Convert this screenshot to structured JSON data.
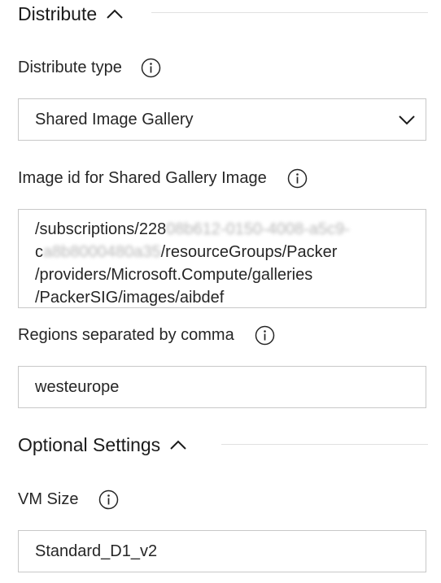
{
  "distribute_section": {
    "title": "Distribute",
    "collapse_icon": "chevron-up-icon"
  },
  "distribute_type": {
    "label": "Distribute type",
    "info_icon": "info-icon",
    "value": "Shared Image Gallery",
    "dropdown_icon": "chevron-down-icon"
  },
  "image_id": {
    "label": "Image id for Shared Gallery Image",
    "info_icon": "info-icon",
    "lines": [
      {
        "prefix": "/subscriptions/228",
        "hidden": "08b612-0150-4008-a5c9-",
        "suffix": ""
      },
      {
        "prefix": "c",
        "hidden": "a8b8000480a35",
        "suffix": "/resourceGroups/Packer"
      },
      {
        "prefix": "/providers/Microsoft.Compute/galleries",
        "hidden": "",
        "suffix": ""
      },
      {
        "prefix": "/PackerSIG/images/aibdef",
        "hidden": "",
        "suffix": ""
      }
    ]
  },
  "regions": {
    "label": "Regions separated by comma",
    "info_icon": "info-icon",
    "value": "westeurope"
  },
  "optional_section": {
    "title": "Optional Settings",
    "collapse_icon": "chevron-up-icon"
  },
  "vm_size": {
    "label": "VM Size",
    "info_icon": "info-icon",
    "value": "Standard_D1_v2"
  }
}
